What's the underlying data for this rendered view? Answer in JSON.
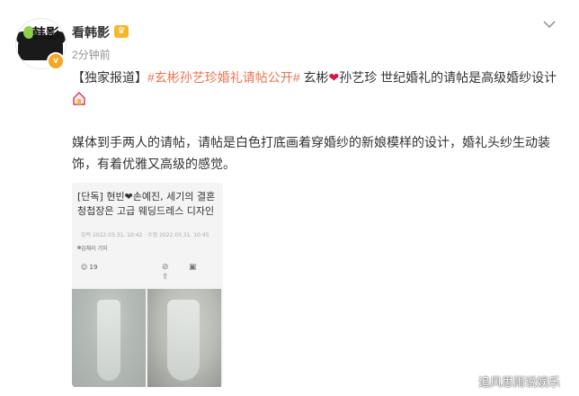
{
  "header": {
    "username": "看韩影",
    "time": "2分钟前",
    "avatar_text": "韩影",
    "verified_badge": "v"
  },
  "post": {
    "tag": "【独家报道】",
    "hashtag": "#玄彬孙艺珍婚礼请帖公开#",
    "text_a": " 玄彬",
    "text_b": "孙艺珍 世纪婚礼的请帖是高级婚纱设计",
    "paragraph2": "媒体到手两人的请帖，请帖是白色打底画着穿婚纱的新娘模样的设计，婚礼头纱生动装饰，有着优雅又高级的感觉。"
  },
  "image": {
    "title": "[단독] 현빈❤손예진, 세기의 결혼 청첩장은 고급 웨딩드레스 디자인",
    "meta": "입력 2022.03.31. 10:42  ·  수정 2022.03.31. 10:45",
    "author": "김채리 기자",
    "reactions": "19",
    "action_icons": "⊘ ▣ ⇧"
  },
  "watermark": "追风思雨说娱乐",
  "icons": {
    "chevron": "chevron-down-icon",
    "heart": "heart-icon",
    "crown": "crown-icon",
    "house": "house-icon"
  },
  "colors": {
    "hashtag": "#eb7350",
    "heart": "#d6143c",
    "verified": "#f5a623"
  }
}
